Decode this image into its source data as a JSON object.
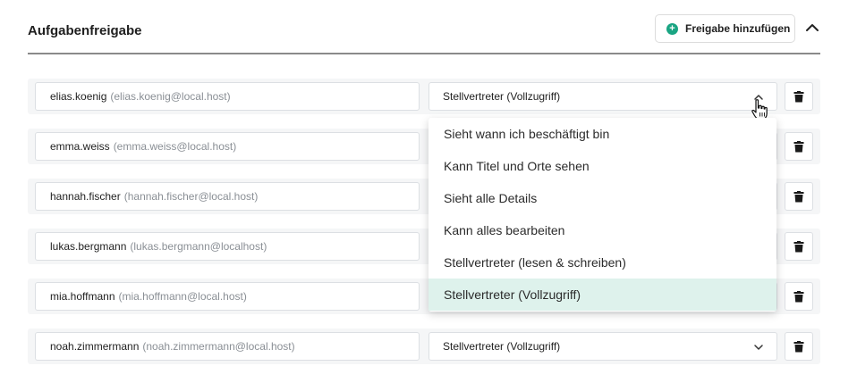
{
  "header": {
    "title": "Aufgabenfreigabe",
    "add_button_label": "Freigabe hinzufügen",
    "add_icon": "plus-circle-icon",
    "collapse_icon": "chevron-up-icon"
  },
  "rows": [
    {
      "name": "elias.koenig",
      "email": "(elias.koenig@local.host)",
      "role": "Stellvertreter (Vollzugriff)"
    },
    {
      "name": "emma.weiss",
      "email": "(emma.weiss@local.host)",
      "role": ""
    },
    {
      "name": "hannah.fischer",
      "email": "(hannah.fischer@local.host)",
      "role": ""
    },
    {
      "name": "lukas.bergmann",
      "email": "(lukas.bergmann@localhost)",
      "role": ""
    },
    {
      "name": "mia.hoffmann",
      "email": "(mia.hoffmann@local.host)",
      "role": ""
    },
    {
      "name": "noah.zimmermann",
      "email": "(noah.zimmermann@local.host)",
      "role": "Stellvertreter (Vollzugriff)"
    }
  ],
  "dropdown": {
    "options": [
      "Sieht wann ich beschäftigt bin",
      "Kann Titel und Orte sehen",
      "Sieht alle Details",
      "Kann alles bearbeiten",
      "Stellvertreter (lesen & schreiben)",
      "Stellvertreter (Vollzugriff)"
    ],
    "selected": "Stellvertreter (Vollzugriff)"
  },
  "icons": {
    "delete": "trash-icon",
    "select_open": "chevron-up-icon",
    "select_closed": "chevron-down-icon",
    "cursor": "hand-pointer-icon"
  },
  "colors": {
    "accent": "#1aa583",
    "selected_option_bg": "#def2ec",
    "row_bg": "#f5f6f7"
  }
}
